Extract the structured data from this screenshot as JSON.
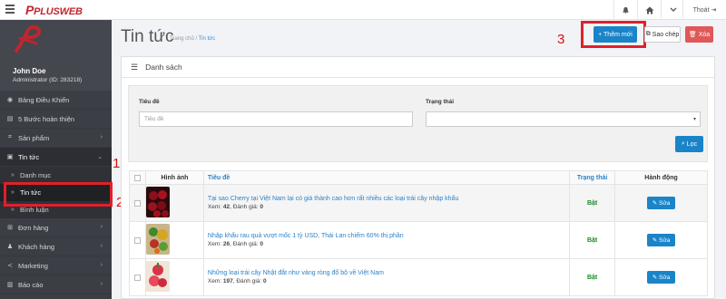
{
  "header": {
    "logo": "PLUSWEB",
    "logout_label": "Thoát"
  },
  "sidebar": {
    "user_name": "John Doe",
    "user_role": "Administrator (ID: 283218)",
    "items": [
      {
        "label": "Bảng Điều Khiển",
        "icon": "dashboard-icon"
      },
      {
        "label": "5 Bước hoàn thiện",
        "icon": "steps-icon"
      },
      {
        "label": "Sản phẩm",
        "icon": "products-icon"
      },
      {
        "label": "Tin tức",
        "icon": "news-icon"
      },
      {
        "label": "Danh mục",
        "icon": "chevron-double-right-icon"
      },
      {
        "label": "Tin tức",
        "icon": "chevron-double-right-icon"
      },
      {
        "label": "Bình luận",
        "icon": "chevron-double-right-icon"
      },
      {
        "label": "Đơn hàng",
        "icon": "cart-icon"
      },
      {
        "label": "Khách hàng",
        "icon": "customers-icon"
      },
      {
        "label": "Marketing",
        "icon": "share-icon"
      },
      {
        "label": "Báo cáo",
        "icon": "report-icon"
      }
    ]
  },
  "annotations": [
    "1",
    "2",
    "3"
  ],
  "page": {
    "title": "Tin tức",
    "breadcrumb_home": "Trang chủ",
    "breadcrumb_sep": "/",
    "breadcrumb_current": "Tin tức",
    "add_label": "+ Thêm mới",
    "copy_label": "Sao chép",
    "delete_label": "Xóa"
  },
  "panel": {
    "title": "Danh sách",
    "filter": {
      "title_label": "Tiêu đề",
      "title_placeholder": "Tiêu đề",
      "status_label": "Trạng thái",
      "status_value": "",
      "filter_button": "Lọc"
    }
  },
  "table": {
    "headers": {
      "image": "Hình ảnh",
      "title": "Tiêu đề",
      "status": "Trạng thái",
      "actions": "Hành động"
    },
    "rows": [
      {
        "title": "Tại sao Cherry tại Việt Nam lại có giá thành cao hơn rất nhiều các loại trái cây nhập khẩu",
        "views_label": "Xem:",
        "views": "42",
        "rating_label": "Đánh giá:",
        "rating": "0",
        "status": "Bật",
        "edit": "Sửa"
      },
      {
        "title": "Nhập khẩu rau quả vượt mốc 1 tỷ USD, Thái Lan chiếm 60% thị phần",
        "views_label": "Xem:",
        "views": "26",
        "rating_label": "Đánh giá:",
        "rating": "0",
        "status": "Bật",
        "edit": "Sửa"
      },
      {
        "title": "Những loại trái cây Nhật đắt như vàng ròng đổ bộ về Việt Nam",
        "views_label": "Xem:",
        "views": "197",
        "rating_label": "Đánh giá:",
        "rating": "0",
        "status": "Bật",
        "edit": "Sửa"
      }
    ]
  },
  "colors": {
    "accent": "#1a84c9",
    "danger": "#e05858",
    "annotation": "#e0202a",
    "sidebar": "#3b3e44",
    "status_on": "#1a8a2a"
  }
}
